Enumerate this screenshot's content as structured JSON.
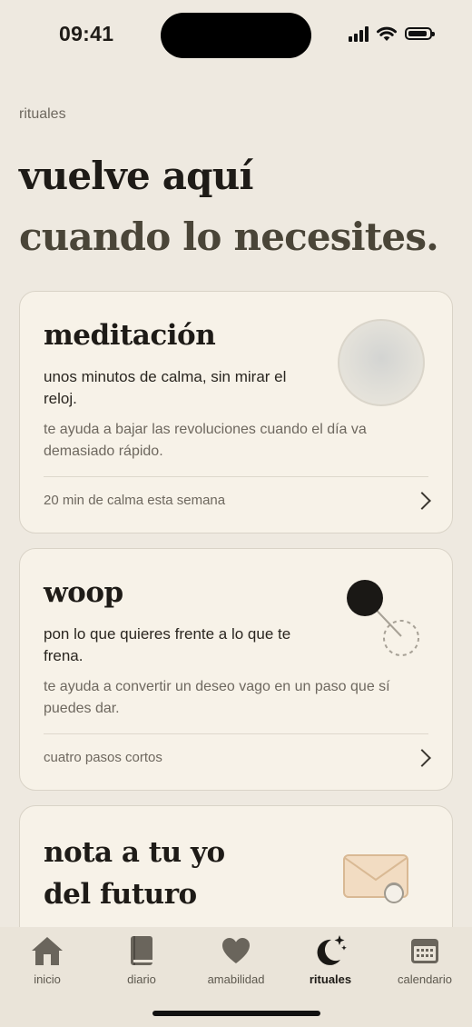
{
  "status_bar": {
    "time": "09:41"
  },
  "header": {
    "kicker": "rituales",
    "title_line1": "vuelve aquí",
    "title_line2": "cuando lo necesites."
  },
  "cards": [
    {
      "title": "meditación",
      "subtitle": "unos minutos de calma, sin mirar el reloj.",
      "description": "te ayuda a bajar las revoluciones cuando el día va demasiado rápido.",
      "footer": "20 min de calma esta semana",
      "icon": "calm-orb-icon"
    },
    {
      "title": "woop",
      "subtitle": "pon lo que quieres frente a lo que te frena.",
      "description": "te ayuda a convertir un deseo vago en un paso que sí puedes dar.",
      "footer": "cuatro pasos cortos",
      "icon": "wish-obstacle-icon"
    },
    {
      "title_line1": "nota a tu yo",
      "title_line2": "del futuro",
      "icon": "sealed-envelope-icon"
    }
  ],
  "tabbar": {
    "items": [
      {
        "label": "inicio",
        "icon": "home-icon"
      },
      {
        "label": "diario",
        "icon": "book-icon"
      },
      {
        "label": "amabilidad",
        "icon": "heart-icon"
      },
      {
        "label": "rituales",
        "icon": "moon-stars-icon",
        "active": true
      },
      {
        "label": "calendario",
        "icon": "calendar-icon"
      }
    ]
  },
  "colors": {
    "background": "#EEE9E0",
    "card": "#F7F2E8",
    "text": "#1E1B17",
    "muted": "#6E685F",
    "accent_envelope": "#F2DCC2"
  }
}
